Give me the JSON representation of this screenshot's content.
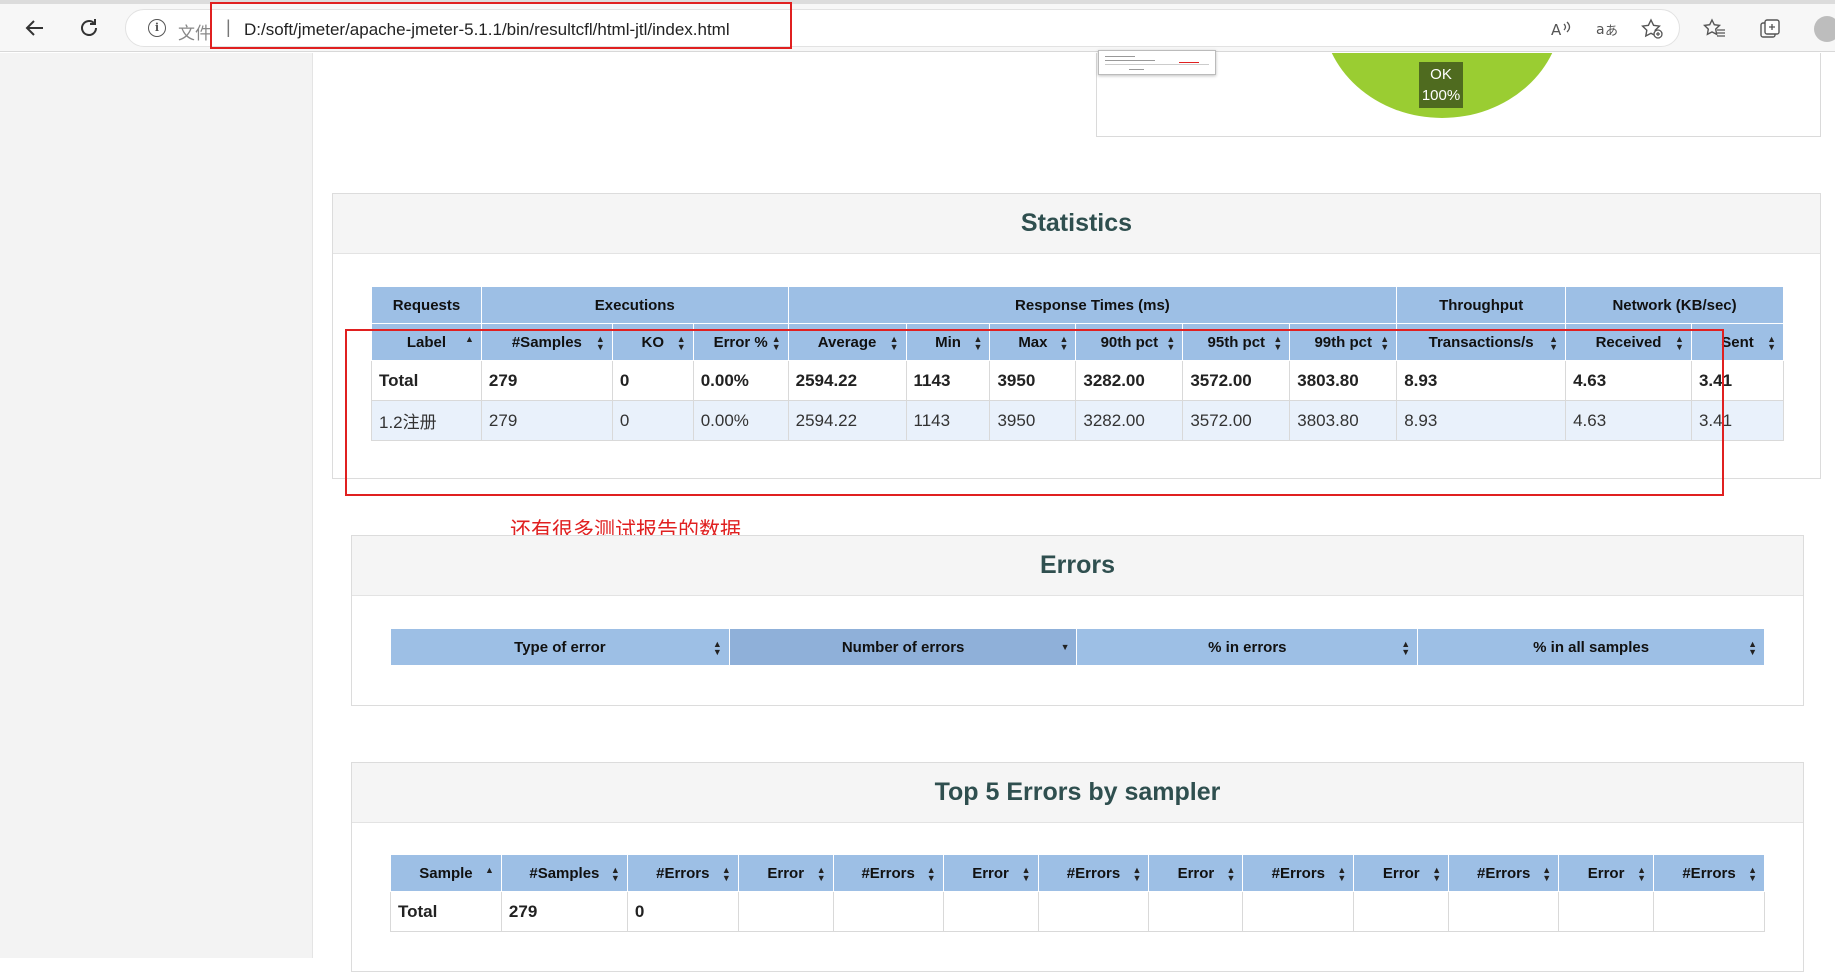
{
  "browser": {
    "protocol_label": "文件",
    "url": "D:/soft/jmeter/apache-jmeter-5.1.1/bin/resultcfl/html-jtl/index.html",
    "icons": [
      "back-arrow-icon",
      "refresh-icon",
      "info-icon",
      "read-aloud-icon",
      "translate-icon",
      "add-favorite-icon",
      "favorites-icon",
      "collections-icon",
      "profile-icon"
    ]
  },
  "apdex": {
    "pie_label_line1": "OK",
    "pie_label_line2": "100%",
    "pie_color": "#9acd32",
    "ok_fraction": 1.0
  },
  "statistics": {
    "title": "Statistics",
    "groups": [
      "Requests",
      "Executions",
      "Response Times (ms)",
      "Throughput",
      "Network (KB/sec)"
    ],
    "columns": [
      "Label",
      "#Samples",
      "KO",
      "Error %",
      "Average",
      "Min",
      "Max",
      "90th pct",
      "95th pct",
      "99th pct",
      "Transactions/s",
      "Received",
      "Sent"
    ],
    "total": [
      "Total",
      "279",
      "0",
      "0.00%",
      "2594.22",
      "1143",
      "3950",
      "3282.00",
      "3572.00",
      "3803.80",
      "8.93",
      "4.63",
      "3.41"
    ],
    "rows": [
      [
        "1.2注册",
        "279",
        "0",
        "0.00%",
        "2594.22",
        "1143",
        "3950",
        "3282.00",
        "3572.00",
        "3803.80",
        "8.93",
        "4.63",
        "3.41"
      ]
    ]
  },
  "annotation": {
    "note": "还有很多测试报告的数据",
    "color": "#e02020"
  },
  "errors": {
    "title": "Errors",
    "columns": [
      "Type of error",
      "Number of errors",
      "% in errors",
      "% in all samples"
    ]
  },
  "top5": {
    "title": "Top 5 Errors by sampler",
    "columns": [
      "Sample",
      "#Samples",
      "#Errors",
      "Error",
      "#Errors",
      "Error",
      "#Errors",
      "Error",
      "#Errors",
      "Error",
      "#Errors",
      "Error",
      "#Errors"
    ],
    "total": [
      "Total",
      "279",
      "0",
      "",
      "",
      "",
      "",
      "",
      "",
      "",
      "",
      "",
      ""
    ]
  }
}
